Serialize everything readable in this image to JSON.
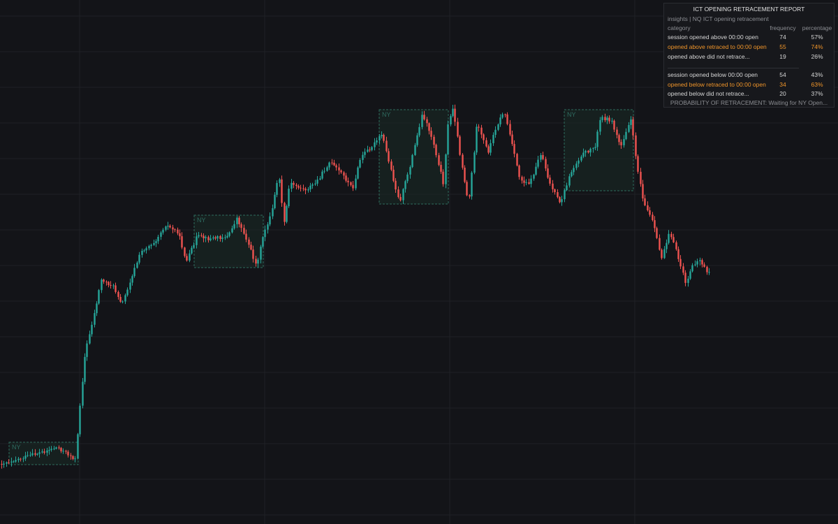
{
  "report": {
    "title": "ICT OPENING RETRACEMENT REPORT",
    "subtitle": "insights | NQ ICT opening retracement",
    "headers": {
      "category": "category",
      "frequency": "frequency",
      "percentage": "percentage"
    },
    "rows": [
      {
        "category": "session opened above 00:00 open",
        "frequency": "74",
        "percentage": "57%",
        "highlight": false
      },
      {
        "category": "opened above retraced to 00:00 open",
        "frequency": "55",
        "percentage": "74%",
        "highlight": true
      },
      {
        "category": "opened above did not retrace...",
        "frequency": "19",
        "percentage": "26%",
        "highlight": false
      },
      {
        "category": "session opened below 00:00 open",
        "frequency": "54",
        "percentage": "43%",
        "highlight": false
      },
      {
        "category": "opened below retraced to 00:00 open",
        "frequency": "34",
        "percentage": "63%",
        "highlight": true
      },
      {
        "category": "opened below did not retrace...",
        "frequency": "20",
        "percentage": "37%",
        "highlight": false
      }
    ],
    "footer": "PROBABILITY OF RETRACEMENT: Waiting for NY Open..."
  },
  "session_label": "NY",
  "colors": {
    "background": "#131418",
    "grid": "#1f2126",
    "bull": "#26a69a",
    "bear": "#ef5350",
    "session_box_border": "#2e6b5e",
    "session_box_fill": "#1a2a26",
    "session_label": "#2f6b60",
    "highlight_text": "#f0952a"
  }
}
